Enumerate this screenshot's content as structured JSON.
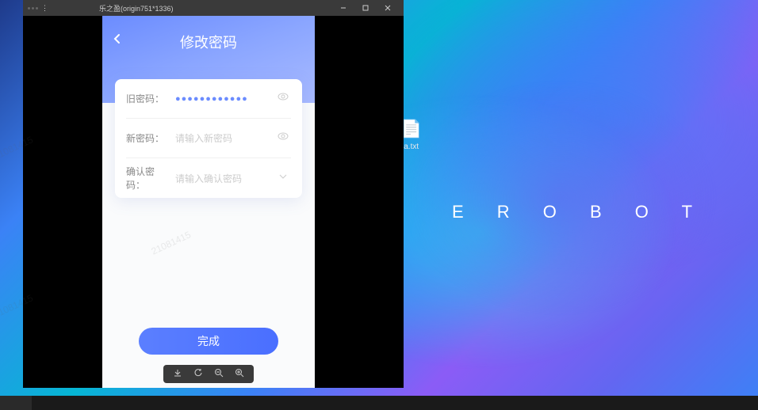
{
  "desktop": {
    "brand": "E R O B O T",
    "icon_label": "a.txt"
  },
  "window": {
    "title": "乐之盈(origin751*1336)"
  },
  "phone": {
    "page_title": "修改密码",
    "form": {
      "old_password_label": "旧密码：",
      "old_password_value": "●●●●●●●●●●●●",
      "new_password_label": "新密码：",
      "new_password_placeholder": "请输入新密码",
      "confirm_password_label": "确认密码：",
      "confirm_password_placeholder": "请输入确认密码"
    },
    "submit_label": "完成"
  },
  "watermark": "21081415"
}
